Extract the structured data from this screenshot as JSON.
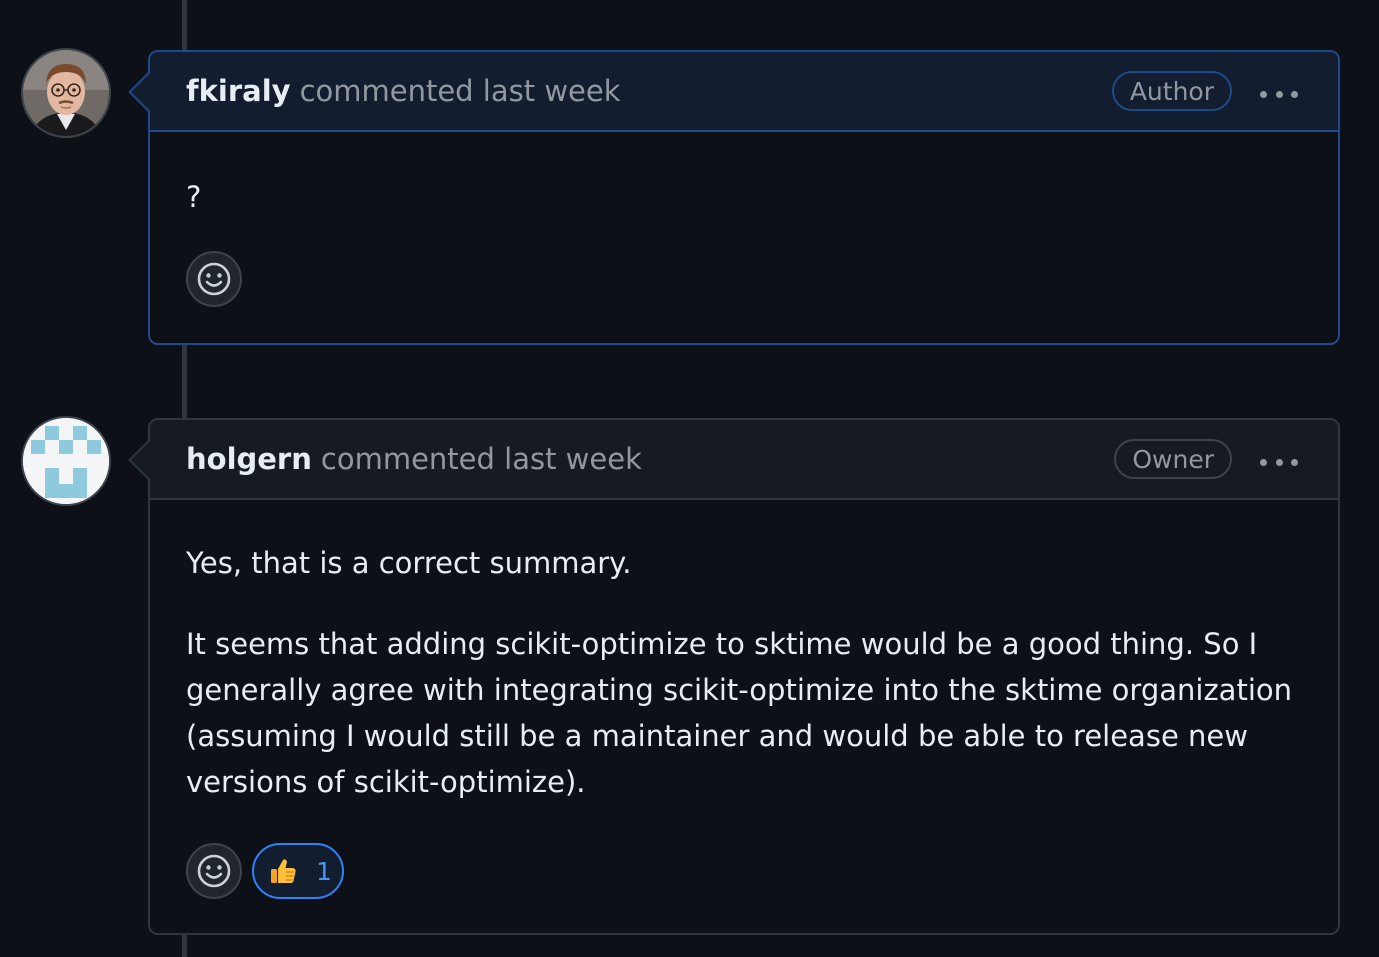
{
  "comments": [
    {
      "username": "fkiraly",
      "meta": "commented last week",
      "role": "Author",
      "body": [
        "?"
      ],
      "reactions": []
    },
    {
      "username": "holgern",
      "meta": "commented last week",
      "role": "Owner",
      "body": [
        "Yes, that is a correct summary.",
        "It seems that adding scikit-optimize to sktime would be a good thing. So I generally agree with integrating scikit-optimize into the sktime organization (assuming I would still be a maintainer and would be able to release new versions of scikit-optimize)."
      ],
      "reactions": [
        {
          "icon": "thumbs-up-icon",
          "count": "1"
        }
      ]
    }
  ],
  "colors": {
    "background": "#0d1117",
    "author_border": "#1f4a8a",
    "reaction_accent": "#2f81f7",
    "muted_text": "#9198a1"
  }
}
